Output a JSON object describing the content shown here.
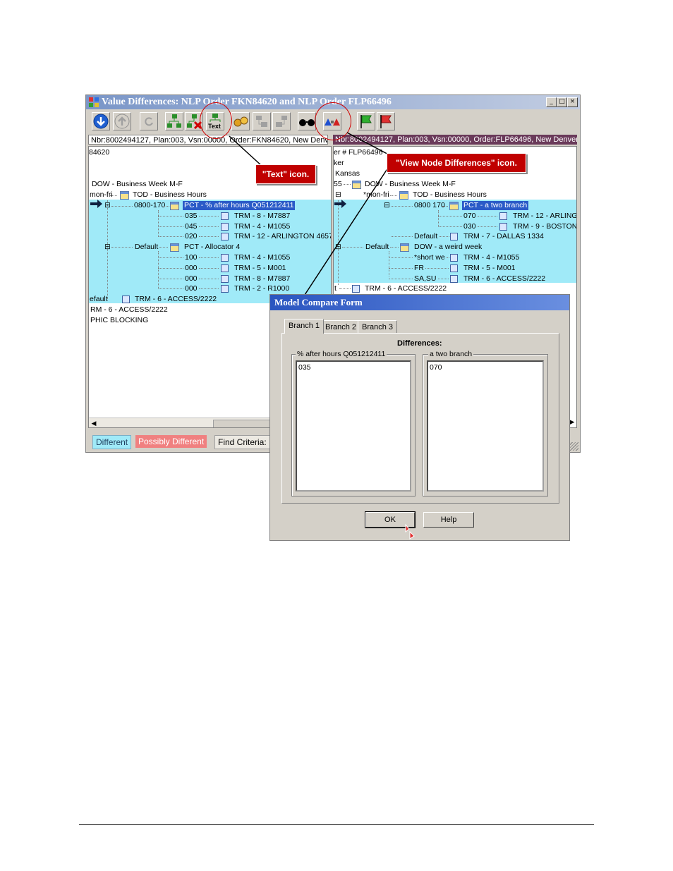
{
  "window": {
    "title": "Value Differences: NLP Order FKN84620 and NLP Order FLP66496",
    "left_path": "Nbr:8002494127, Plan:003, Vsn:00000, Order:FKN84620, New Denver",
    "right_path": "Nbr:8002494127, Plan:003, Vsn:00000, Order:FLP66496, New Denver"
  },
  "left_tree": {
    "line1": "84620",
    "line2": "DOW - Business Week M-F",
    "line3_key": "mon-fri",
    "line3_val": "TOD - Business Hours",
    "b1_key": "0800-170",
    "b1_val": "PCT - % after hours  Q051212411",
    "r1_key": "035",
    "r1_val": "TRM - 8 - M7887",
    "r2_key": "045",
    "r2_val": "TRM - 4 - M1055",
    "r3_key": "020",
    "r3_val": "TRM - 12 - ARLINGTON 4657",
    "b2_key": "Default",
    "b2_val": "PCT - Allocator 4",
    "r4_key": "100",
    "r4_val": "TRM - 4 - M1055",
    "r5_key": "000",
    "r5_val": "TRM - 5 - M001",
    "r6_key": "000",
    "r6_val": "TRM - 8 - M7887",
    "r7_key": "000",
    "r7_val": "TRM - 2 - R1000",
    "d_key": "efault",
    "d_val": "TRM - 6 - ACCESS/2222",
    "line_a": "RM - 6 - ACCESS/2222",
    "line_b": "PHIC BLOCKING"
  },
  "right_tree": {
    "line1": "er # FLP66496",
    "line2": "ker",
    "line3": "Kansas",
    "line4_key": "55",
    "line4_val": "DOW - Business Week M-F",
    "line5_key": "*mon-fri",
    "line5_val": "TOD - Business Hours",
    "b1_key": "0800 170",
    "b1_val": "PCT - a two branch",
    "r1_key": "070",
    "r1_val": "TRM - 12 - ARLING",
    "r2_key": "030",
    "r2_val": "TRM - 9 - BOSTON",
    "r3_key": "Default",
    "r3_val": "TRM - 7 - DALLAS 1334",
    "b2_key": "Default",
    "b2_val": "DOW - a weird week",
    "r4_key": "*short we",
    "r4_val": "TRM - 4 - M1055",
    "r5_key": "FR",
    "r5_val": "TRM - 5 - M001",
    "r6_key": "SA,SU",
    "r6_val": "TRM - 6 - ACCESS/2222",
    "d_key": "t",
    "d_val": "TRM - 6 - ACCESS/2222"
  },
  "legend": {
    "different": "Different",
    "possibly_different": "Possibly Different",
    "find_criteria": "Find Criteria: I"
  },
  "callouts": {
    "text_icon": "\"Text\" icon.",
    "view_node_differences": "\"View Node Differences\" icon."
  },
  "toolbar": {
    "text_label": "Text"
  },
  "dialog": {
    "title": "Model Compare Form",
    "tabs": [
      "Branch 1",
      "Branch 2",
      "Branch 3"
    ],
    "differences_label": "Differences:",
    "left_group": "% after hours  Q051212411",
    "right_group": "a two branch",
    "left_items": [
      "035"
    ],
    "right_items": [
      "070"
    ],
    "ok_label": "OK",
    "help_label": "Help"
  },
  "colors": {
    "different": "#a0eaf8",
    "possibly_different": "#f08080",
    "callout": "#c00000"
  }
}
